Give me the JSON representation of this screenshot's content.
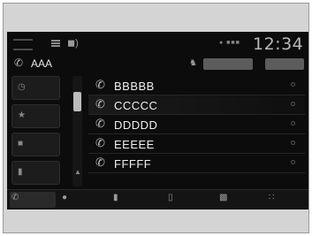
{
  "status_bar": {
    "clock": "12:34",
    "icons": [
      "app-logo-icon",
      "menu-icon",
      "volume-icon",
      "signal-icon"
    ]
  },
  "caller": {
    "name": "AAA",
    "icon": "phone-icon"
  },
  "header_buttons": {
    "contact_icon": "contact-icon"
  },
  "left_menu": {
    "items": [
      {
        "icon": "recent-calls-icon"
      },
      {
        "icon": "favorites-icon"
      },
      {
        "icon": "contacts-icon"
      },
      {
        "icon": "keypad-icon"
      }
    ]
  },
  "call_list": {
    "rows": [
      {
        "name": "BBBBB",
        "icon": "outgoing-call-icon"
      },
      {
        "name": "CCCCC",
        "icon": "outgoing-call-icon"
      },
      {
        "name": "DDDDD",
        "icon": "outgoing-call-icon"
      },
      {
        "name": "EEEEE",
        "icon": "outgoing-call-icon"
      },
      {
        "name": "FFFFF",
        "icon": "outgoing-call-icon"
      }
    ]
  },
  "bottom_bar": {
    "items": [
      {
        "icon": "phone-icon",
        "active": true
      },
      {
        "icon": "mute-icon",
        "active": false
      },
      {
        "icon": "audio-icon",
        "active": false
      },
      {
        "icon": "handset-icon",
        "active": false
      },
      {
        "icon": "transfer-icon",
        "active": false
      },
      {
        "icon": "dialpad-icon",
        "active": false
      }
    ]
  },
  "colors": {
    "screen_bg": "#0c0c0c",
    "frame_bg": "#d4d4d4",
    "text": "#f0f0f0"
  }
}
